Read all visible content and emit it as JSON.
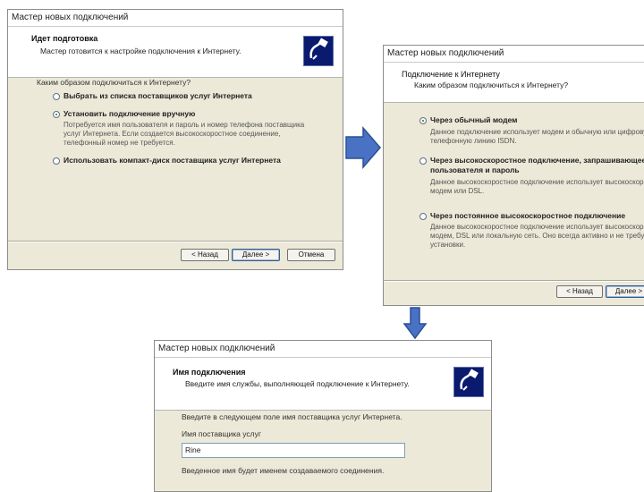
{
  "window1": {
    "title": "Мастер новых подключений",
    "header_title": "Идет подготовка",
    "header_subtitle": "Мастер готовится к настройке подключения к Интернету.",
    "question": "Каким образом подключиться к Интернету?",
    "options": [
      {
        "label": "Выбрать из списка поставщиков услуг Интернета",
        "selected": false
      },
      {
        "label": "Установить подключение вручную",
        "selected": true,
        "description": "Потребуется имя пользователя и пароль и номер телефона поставщика\nуслуг Интернета. Если создается высокоскоростное соединение,\nтелефонный номер не требуется."
      },
      {
        "label": "Использовать компакт-диск поставщика услуг Интернета",
        "selected": false
      }
    ],
    "back_button": "< Назад",
    "next_button": "Далее >",
    "cancel_button": "Отмена"
  },
  "window2": {
    "title": "Мастер новых подключений",
    "header_title": "Подключение к Интернету",
    "header_subtitle": "Каким образом подключиться к Интернету?",
    "options": [
      {
        "label": "Через обычный модем",
        "selected": true,
        "description": "Данное подключение использует модем и обычную или цифровую\nтелефонную линию ISDN."
      },
      {
        "label": "Через высокоскоростное подключение, запрашивающее\nпользователя и пароль",
        "selected": false,
        "description": "Данное высокоскоростное подключение использует высокоскоростной\nмодем или DSL."
      },
      {
        "label": "Через постоянное высокоскоростное подключение",
        "selected": false,
        "description": "Данное высокоскоростное подключение использует высокоскоростной\nмодем, DSL или локальную сеть. Оно всегда активно и не требует\nустановки."
      }
    ],
    "back_button": "< Назад",
    "next_button": "Далее >"
  },
  "window3": {
    "title": "Мастер новых подключений",
    "header_title": "Имя подключения",
    "header_subtitle": "Введите имя службы, выполняющей подключение к Интернету.",
    "prompt": "Введите в следующем поле имя поставщика услуг Интернета.",
    "field_label": "Имя поставщика услуг",
    "field_value": "Rine",
    "footnote": "Введенное имя будет именем создаваемого соединения."
  },
  "colors": {
    "arrow_fill": "#4a72c4",
    "arrow_stroke": "#2b4f94",
    "window_bg": "#ece9d8"
  }
}
